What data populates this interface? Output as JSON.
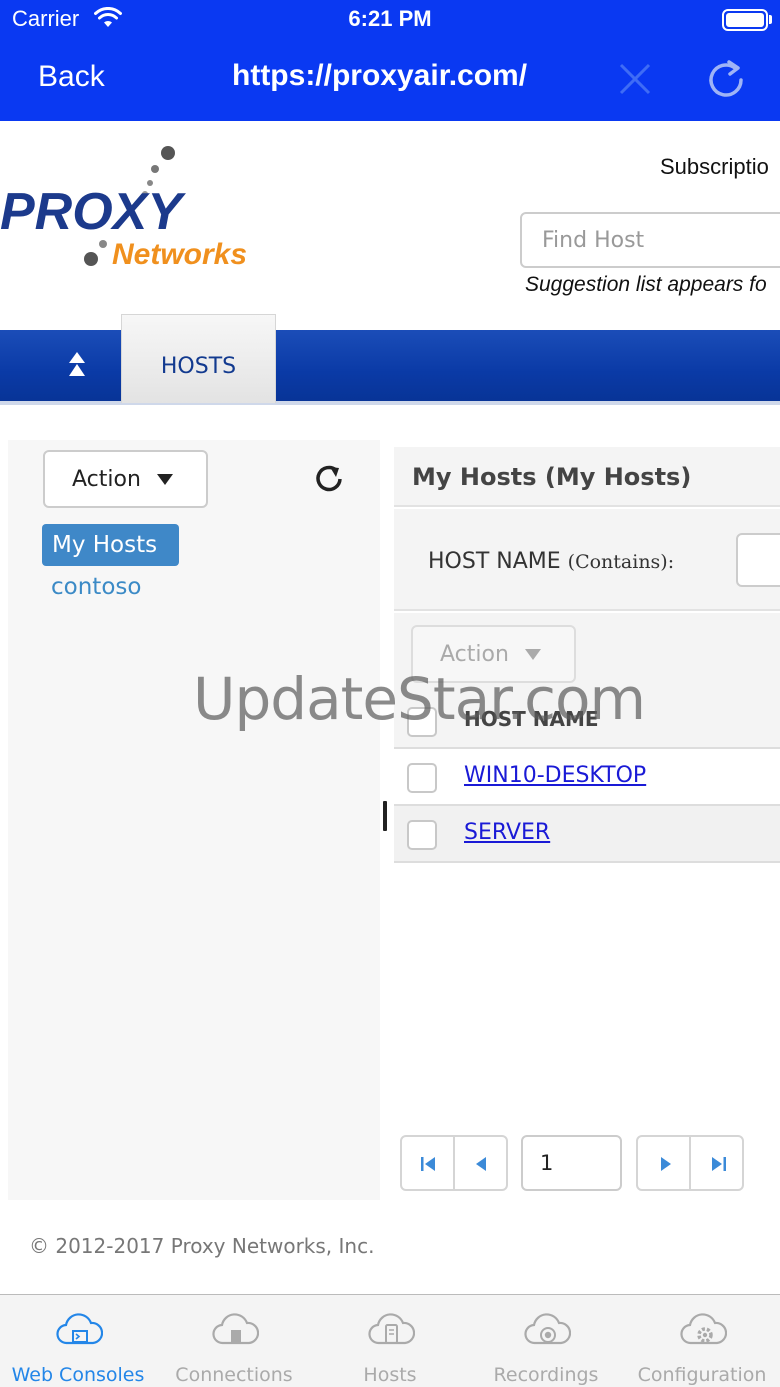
{
  "status_bar": {
    "carrier": "Carrier",
    "time": "6:21 PM"
  },
  "browser": {
    "back_label": "Back",
    "url": "https://proxyair.com/"
  },
  "header": {
    "logo_word1": "PROXY",
    "logo_word2": "Networks",
    "subscription": "Subscriptio",
    "find_host_placeholder": "Find Host",
    "suggestion_text": "Suggestion list appears fo"
  },
  "tabs": {
    "hosts_label": "HOSTS"
  },
  "left_pane": {
    "action_label": "Action",
    "tree": [
      {
        "label": "My Hosts",
        "selected": true
      },
      {
        "label": "contoso",
        "selected": false
      }
    ]
  },
  "right_pane": {
    "title": "My Hosts (My Hosts)",
    "filter_label": "HOST NAME",
    "filter_hint": "(Contains):",
    "action_label": "Action",
    "column_header": "HOST NAME",
    "rows": [
      {
        "name": "WIN10-DESKTOP"
      },
      {
        "name": "SERVER"
      }
    ],
    "page": "1"
  },
  "watermark": "UpdateStar.com",
  "footer": "© 2012-2017 Proxy Networks, Inc.",
  "bottom_tabs": [
    {
      "label": "Web Consoles",
      "icon": "cloud-console-icon",
      "active": true
    },
    {
      "label": "Connections",
      "icon": "cloud-connections-icon",
      "active": false
    },
    {
      "label": "Hosts",
      "icon": "cloud-hosts-icon",
      "active": false
    },
    {
      "label": "Recordings",
      "icon": "cloud-recordings-icon",
      "active": false
    },
    {
      "label": "Configuration",
      "icon": "cloud-configuration-icon",
      "active": false
    }
  ],
  "colors": {
    "top_bar": "#0a39f2",
    "tab_bar": "#0a3aa6",
    "selected_tree": "#3f88c8",
    "active_tab": "#2386e8",
    "link": "#1a1ad6"
  }
}
